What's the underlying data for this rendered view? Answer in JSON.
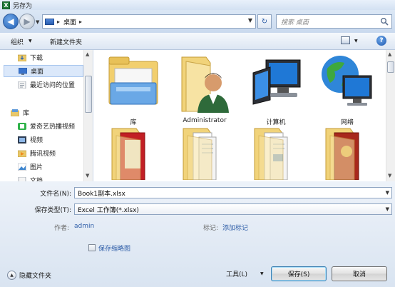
{
  "window": {
    "title": "另存为",
    "app_icon_letter": "X"
  },
  "nav": {
    "address_path": "桌面",
    "search_placeholder": "搜索 桌面"
  },
  "toolbar": {
    "organize_label": "组织",
    "new_folder_label": "新建文件夹",
    "help_label": "?"
  },
  "sidebar": {
    "items": [
      {
        "label": "下载",
        "icon": "download-folder-icon",
        "selected": false
      },
      {
        "label": "桌面",
        "icon": "desktop-icon",
        "selected": true
      },
      {
        "label": "最近访问的位置",
        "icon": "recent-places-icon",
        "selected": false
      },
      {
        "label": "库",
        "icon": "library-icon",
        "selected": false
      },
      {
        "label": "爱奇艺热播视频",
        "icon": "iqiyi-icon",
        "selected": false
      },
      {
        "label": "视频",
        "icon": "video-library-icon",
        "selected": false
      },
      {
        "label": "腾讯视频",
        "icon": "tencent-video-icon",
        "selected": false
      },
      {
        "label": "图片",
        "icon": "pictures-library-icon",
        "selected": false
      },
      {
        "label": "文档",
        "icon": "documents-library-icon",
        "selected": false
      }
    ]
  },
  "files": [
    {
      "label": "库",
      "icon": "library-folder-icon"
    },
    {
      "label": "Administrator",
      "icon": "user-folder-icon"
    },
    {
      "label": "计算机",
      "icon": "computer-icon"
    },
    {
      "label": "网络",
      "icon": "network-icon"
    },
    {
      "label": "",
      "icon": "folder-red-doc-icon"
    },
    {
      "label": "",
      "icon": "folder-docs-icon"
    },
    {
      "label": "",
      "icon": "folder-docs-icon"
    },
    {
      "label": "",
      "icon": "folder-red-doc-icon"
    }
  ],
  "form": {
    "filename_label": "文件名(N):",
    "filename_value": "Book1副本.xlsx",
    "filetype_label": "保存类型(T):",
    "filetype_value": "Excel 工作簿(*.xlsx)",
    "author_label": "作者:",
    "author_value": "admin",
    "tags_label": "标记:",
    "tags_value": "添加标记",
    "thumbnail_label": "保存缩略图",
    "thumbnail_checked": false
  },
  "footer": {
    "hide_folders_label": "隐藏文件夹",
    "tools_label": "工具(L)",
    "save_label": "保存(S)",
    "cancel_label": "取消"
  },
  "colors": {
    "link": "#2f5ea8",
    "selection": "#dbe8fa",
    "chrome": "#ccd9ea"
  }
}
